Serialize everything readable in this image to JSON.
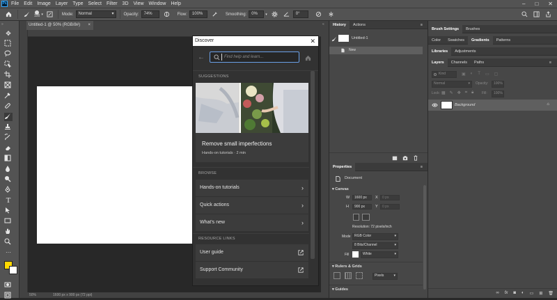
{
  "menubar": {
    "logo": "Ps",
    "items": [
      "File",
      "Edit",
      "Image",
      "Layer",
      "Type",
      "Select",
      "Filter",
      "3D",
      "View",
      "Window",
      "Help"
    ]
  },
  "options": {
    "brush_size": "100",
    "mode_label": "Mode:",
    "mode_value": "Normal",
    "opacity_label": "Opacity:",
    "opacity_value": "74%",
    "flow_label": "Flow:",
    "flow_value": "100%",
    "smoothing_label": "Smoothing:",
    "smoothing_value": "0%",
    "angle_value": "0°"
  },
  "document": {
    "tab_title": "Untitled-1 @ 50% (RGB/8#)",
    "zoom": "50%",
    "dimensions": "1600 px x 900 px (72 ppi)"
  },
  "discover": {
    "title": "Discover",
    "search_placeholder": "Find help and learn...",
    "suggestions_heading": "SUGGESTIONS",
    "card_title": "Remove small imperfections",
    "card_meta": "Hands-on tutorials · 2 min",
    "browse_heading": "BROWSE",
    "browse_items": [
      "Hands-on tutorials",
      "Quick actions",
      "What's new"
    ],
    "resources_heading": "RESOURCE LINKS",
    "resource_items": [
      "User guide",
      "Support Community"
    ]
  },
  "history": {
    "tabs": [
      "History",
      "Actions"
    ],
    "snapshot": "Untitled-1",
    "state": "New"
  },
  "properties": {
    "tab": "Properties",
    "doc_label": "Document",
    "canvas_section": "Canvas",
    "w_label": "W",
    "w_value": "1600 px",
    "h_label": "H",
    "h_value": "900 px",
    "x_label": "X",
    "x_value": "0 px",
    "y_label": "Y",
    "y_value": "0 px",
    "resolution": "Resolution: 72 pixels/inch",
    "mode_label": "Mode",
    "mode_value": "RGB Color",
    "depth_value": "8 Bits/Channel",
    "fill_label": "Fill",
    "fill_value": "White",
    "rulers_section": "Rulers & Grids",
    "units_value": "Pixels",
    "guides_section": "Guides"
  },
  "right": {
    "tabs1": [
      "Brush Settings",
      "Brushes"
    ],
    "tabs2": [
      "Color",
      "Swatches",
      "Gradients",
      "Patterns"
    ],
    "tabs3": [
      "Libraries",
      "Adjustments"
    ],
    "tabs4": [
      "Layers",
      "Channels",
      "Paths"
    ],
    "kind": "Kind",
    "blend": "Normal",
    "opacity_label": "Opacity:",
    "opacity_value": "100%",
    "lock_label": "Lock:",
    "fill_label": "Fill:",
    "fill_value": "100%",
    "layer_name": "Background"
  },
  "colors": {
    "foreground": "#ffd800",
    "background": "#ffffff",
    "accent": "#31a8ff"
  }
}
